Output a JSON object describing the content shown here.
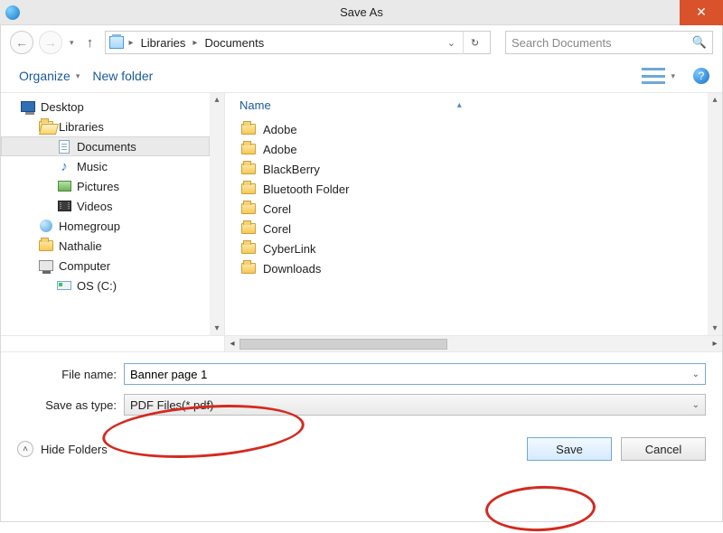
{
  "title": "Save As",
  "nav": {
    "crumb1": "Libraries",
    "crumb2": "Documents",
    "search_placeholder": "Search Documents"
  },
  "toolbar": {
    "organize": "Organize",
    "newfolder": "New folder"
  },
  "tree": {
    "desktop": "Desktop",
    "libraries": "Libraries",
    "documents": "Documents",
    "music": "Music",
    "pictures": "Pictures",
    "videos": "Videos",
    "homegroup": "Homegroup",
    "nathalie": "Nathalie",
    "computer": "Computer",
    "osc": "OS (C:)"
  },
  "list": {
    "header_name": "Name",
    "items": [
      "Adobe",
      "Adobe",
      "BlackBerry",
      "Bluetooth Folder",
      "Corel",
      "Corel",
      "CyberLink",
      "Downloads"
    ]
  },
  "form": {
    "filename_label": "File name:",
    "filename_value": "Banner page 1",
    "type_label": "Save as type:",
    "type_value": "PDF Files(*.pdf)"
  },
  "footer": {
    "hide": "Hide Folders",
    "save": "Save",
    "cancel": "Cancel"
  }
}
